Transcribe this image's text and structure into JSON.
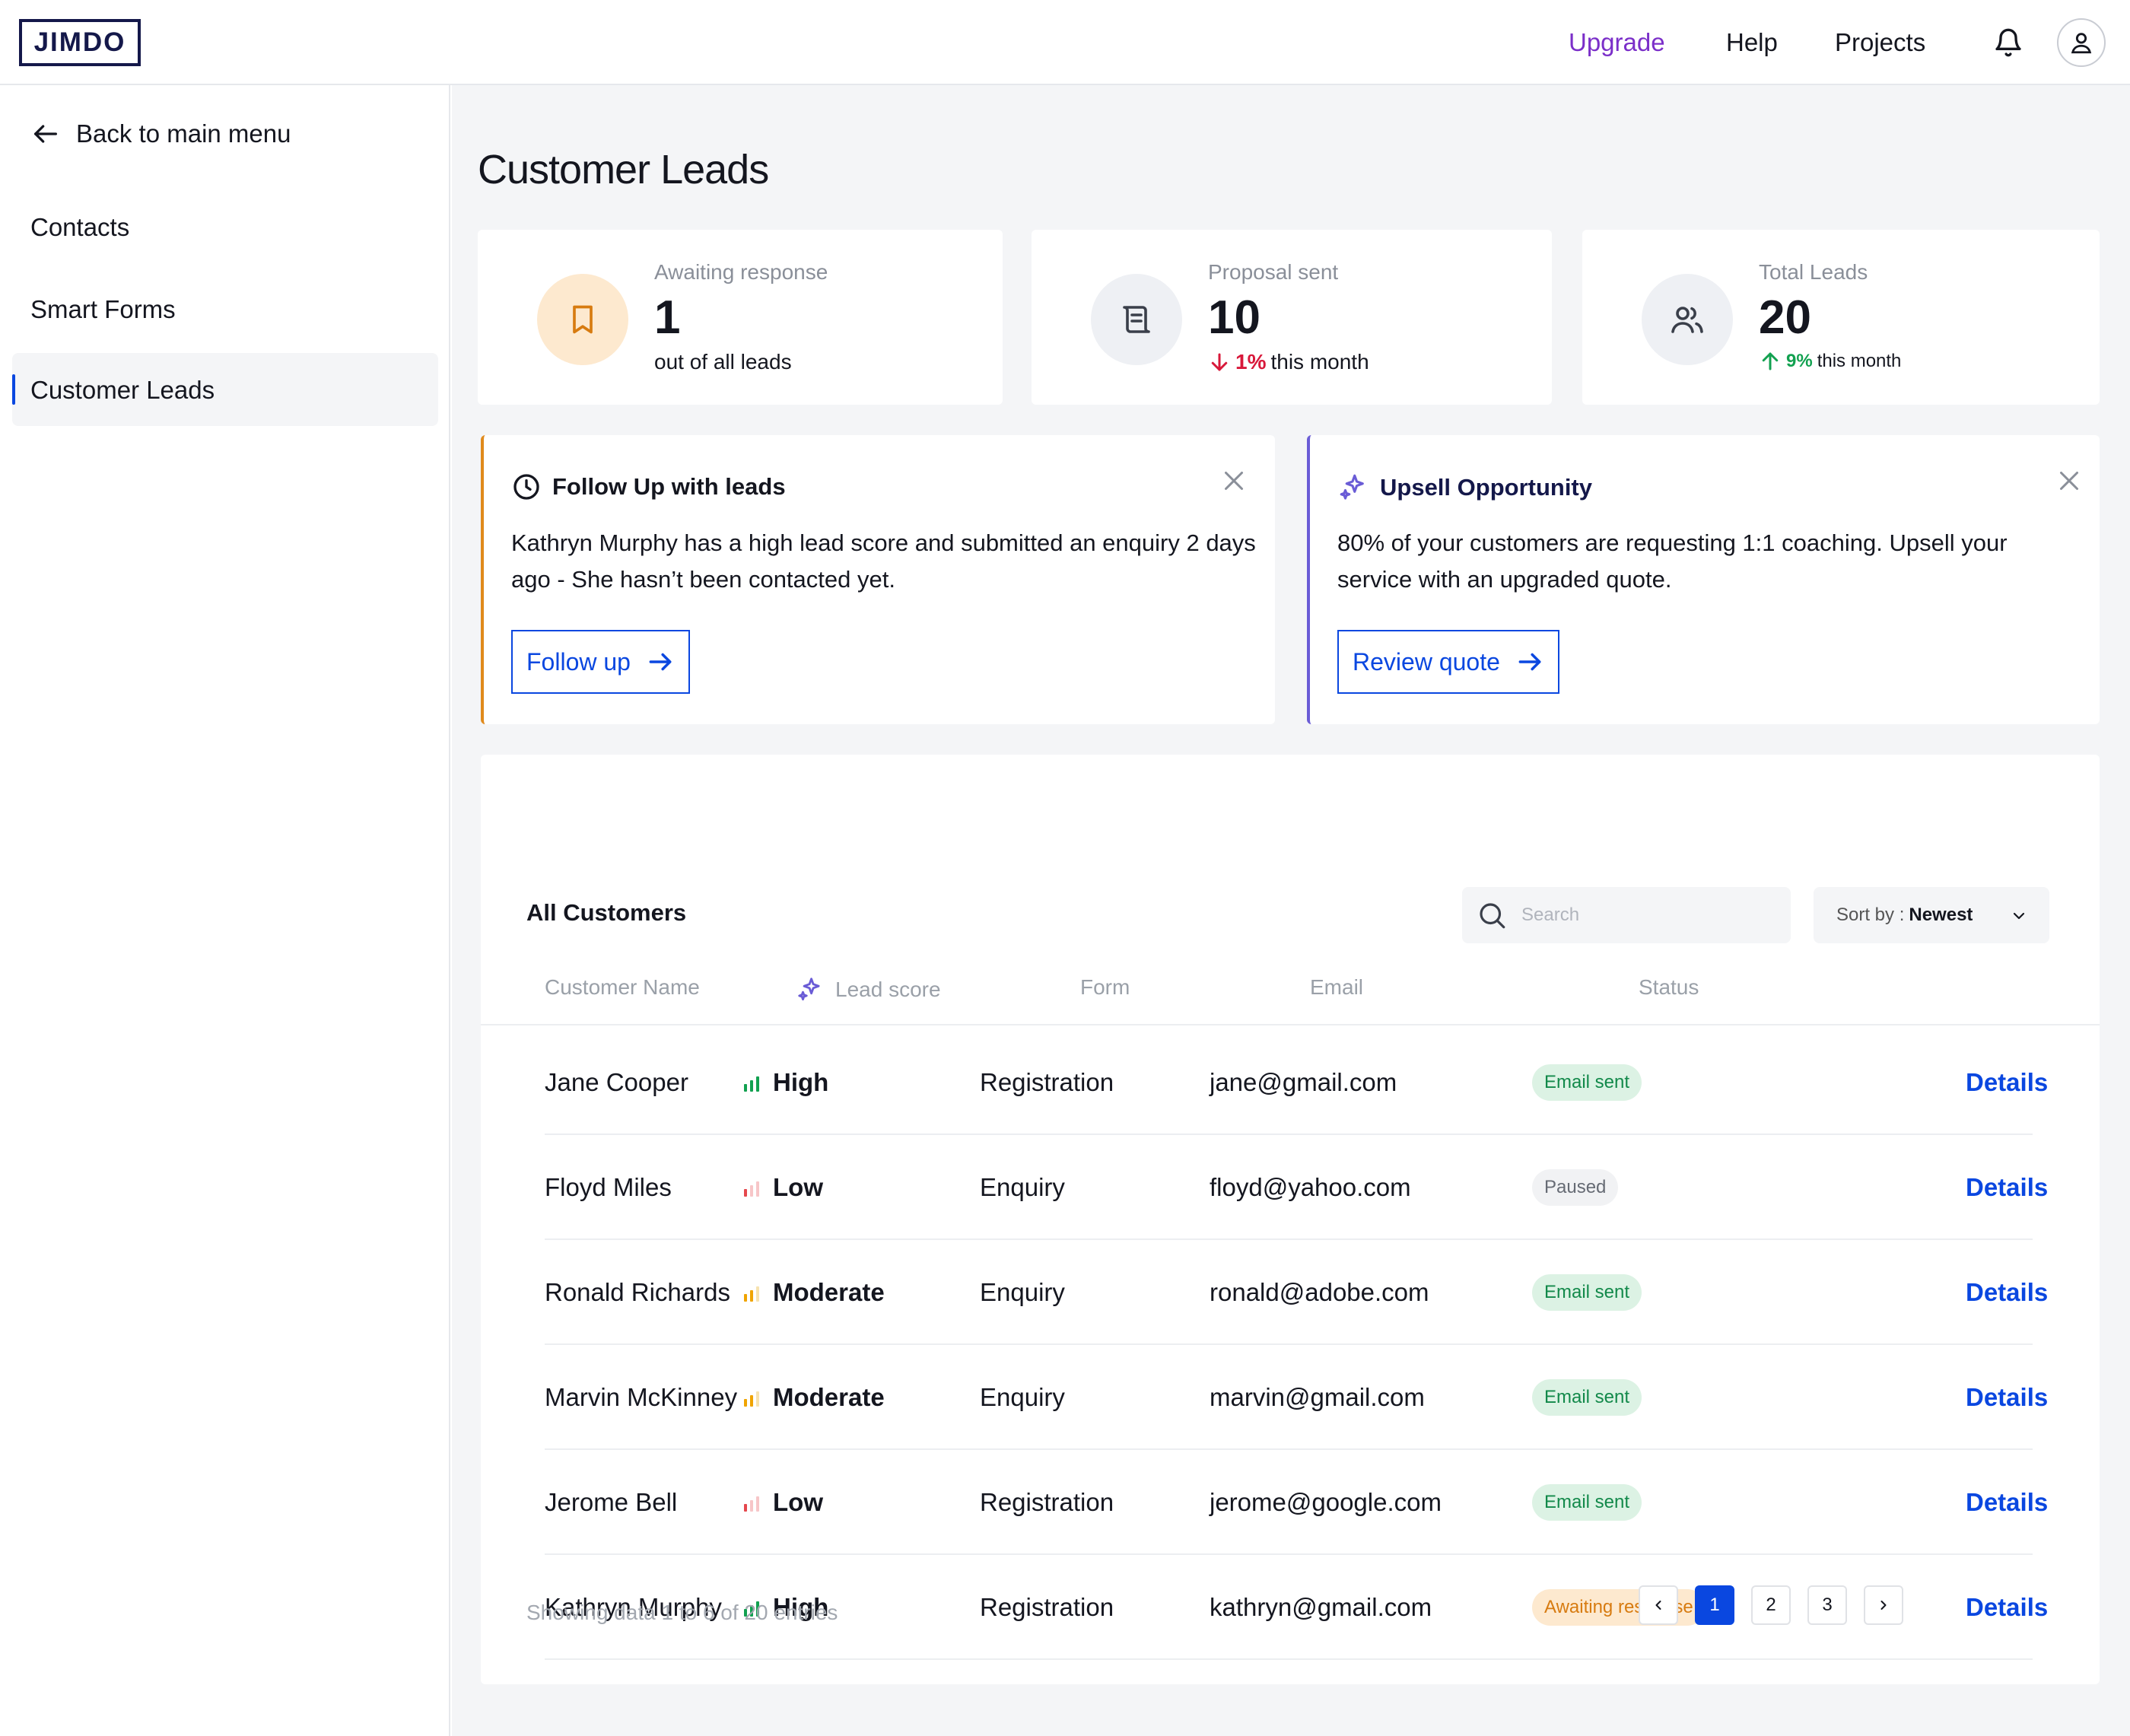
{
  "header": {
    "logo": "JIMDO",
    "nav": {
      "upgrade": "Upgrade",
      "help": "Help",
      "projects": "Projects"
    },
    "icons": {
      "bell": "bell-icon",
      "profile": "user-icon"
    }
  },
  "sidebar": {
    "back": "Back to main menu",
    "items": [
      {
        "label": "Contacts"
      },
      {
        "label": "Smart Forms"
      },
      {
        "label": "Customer Leads"
      }
    ],
    "active_index": 2
  },
  "page": {
    "title": "Customer Leads"
  },
  "stats": [
    {
      "label": "Awaiting response",
      "value": "1",
      "sub": "out of all leads",
      "icon": "bookmark-icon"
    },
    {
      "label": "Proposal sent",
      "value": "10",
      "delta": "1%",
      "delta_direction": "down",
      "sub": "this month",
      "icon": "scroll-icon"
    },
    {
      "label": "Total Leads",
      "value": "20",
      "delta": "9%",
      "delta_direction": "up",
      "sub": "this month",
      "icon": "users-icon"
    }
  ],
  "alerts": [
    {
      "title": "Follow Up with leads",
      "text": "Kathryn Murphy has a high lead score and submitted an enquiry 2 days ago - She hasn’t been contacted yet.",
      "button": "Follow up",
      "accent": "#e08a1c"
    },
    {
      "title": "Upsell Opportunity",
      "text": "80% of your customers are requesting 1:1 coaching. Upsell your service with an upgraded quote.",
      "button": "Review quote",
      "accent": "#6a5cd6"
    }
  ],
  "table": {
    "title": "All Customers",
    "search_placeholder": "Search",
    "sort_label": "Sort by :",
    "sort_value": "Newest",
    "columns": [
      "Customer Name",
      "Lead score",
      "Form",
      "Email",
      "Status"
    ],
    "rows": [
      {
        "name": "Jane Cooper",
        "score": "High",
        "form": "Registration",
        "email": "jane@gmail.com",
        "status": "Email sent",
        "action": "Details"
      },
      {
        "name": "Floyd Miles",
        "score": "Low",
        "form": "Enquiry",
        "email": "floyd@yahoo.com",
        "status": "Paused",
        "action": "Details"
      },
      {
        "name": "Ronald Richards",
        "score": "Moderate",
        "form": "Enquiry",
        "email": "ronald@adobe.com",
        "status": "Email sent",
        "action": "Details"
      },
      {
        "name": "Marvin McKinney",
        "score": "Moderate",
        "form": "Enquiry",
        "email": "marvin@gmail.com",
        "status": "Email sent",
        "action": "Details"
      },
      {
        "name": "Jerome Bell",
        "score": "Low",
        "form": "Registration",
        "email": "jerome@google.com",
        "status": "Email sent",
        "action": "Details"
      },
      {
        "name": "Kathryn Murphy",
        "score": "High",
        "form": "Registration",
        "email": "kathryn@gmail.com",
        "status": "Awaiting response",
        "action": "Details"
      }
    ],
    "footer": "Showing data 1 to 6 of  20 entries",
    "pages": [
      "1",
      "2",
      "3"
    ],
    "current_page": "1"
  },
  "colors": {
    "accent_blue": "#0a47e0",
    "upgrade_purple": "#7b2fc9",
    "score_high": "#12a150",
    "score_moderate": "#f0a400",
    "score_low": "#e5484d"
  }
}
